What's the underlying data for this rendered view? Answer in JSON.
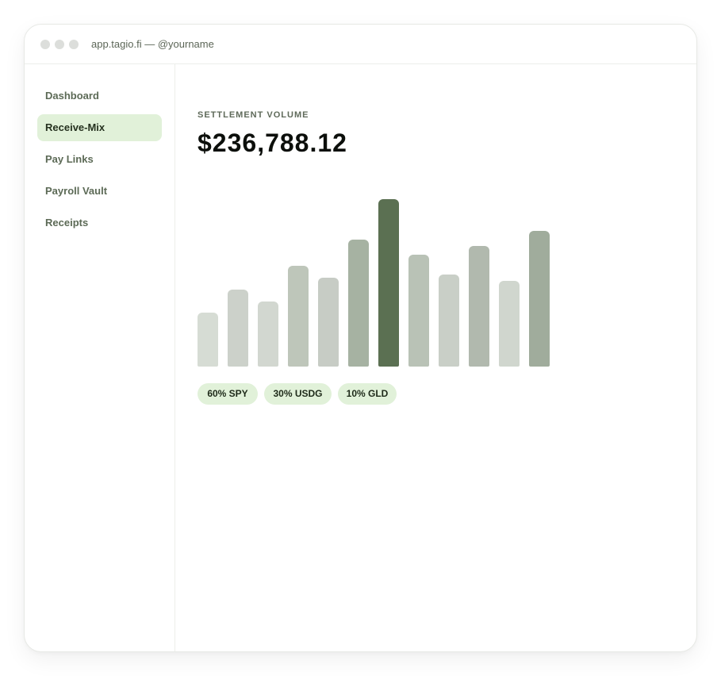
{
  "window": {
    "url_label": "app.tagio.fi — @yourname"
  },
  "sidebar": {
    "items": [
      {
        "label": "Dashboard",
        "active": false
      },
      {
        "label": "Receive-Mix",
        "active": true
      },
      {
        "label": "Pay Links",
        "active": false
      },
      {
        "label": "Payroll Vault",
        "active": false
      },
      {
        "label": "Receipts",
        "active": false
      }
    ]
  },
  "main": {
    "kicker": "SETTLEMENT VOLUME",
    "amount": "$236,788.12",
    "chips": [
      "60% SPY",
      "30% USDG",
      "10% GLD"
    ]
  },
  "colors": {
    "accent": "#5b7052",
    "chip_bg": "#e1f1d9",
    "active_nav_bg": "#e1f1d9"
  },
  "chart_data": {
    "type": "bar",
    "title": "",
    "xlabel": "",
    "ylabel": "",
    "ylim": [
      0,
      100
    ],
    "grid": false,
    "values": [
      32,
      46,
      39,
      60,
      53,
      76,
      100,
      67,
      55,
      72,
      51,
      81
    ],
    "colors": [
      "#d6dcd4",
      "#ccd1ca",
      "#d2d7d0",
      "#bec6ba",
      "#c7ccc5",
      "#a6b2a2",
      "#5b7052",
      "#b9c2b6",
      "#c9cfc7",
      "#b1b9ae",
      "#d0d6ce",
      "#a0ac9c"
    ]
  }
}
